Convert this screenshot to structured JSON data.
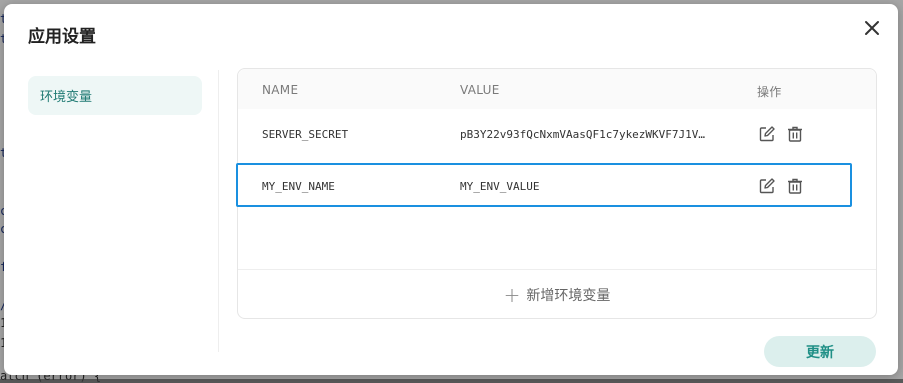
{
  "background_code": {
    "bottom_line": "atch (error) {"
  },
  "dialog": {
    "title": "应用设置",
    "close_icon": "close-icon"
  },
  "sidebar": {
    "items": [
      {
        "label": "环境变量",
        "active": true
      }
    ]
  },
  "env_table": {
    "headers": {
      "name": "NAME",
      "value": "VALUE",
      "actions": "操作"
    },
    "rows": [
      {
        "name": "SERVER_SECRET",
        "value": "pB3Y22v93fQcNxmVAasQF1c7ykezWKVF7J1V…"
      },
      {
        "name": "MY_ENV_NAME",
        "value": "MY_ENV_VALUE"
      }
    ],
    "add_label": "新增环境变量"
  },
  "footer": {
    "update_label": "更新"
  },
  "colors": {
    "accent": "#1f8f86",
    "selected_border": "#1a90e0",
    "sidebar_active_bg": "#eef7f6"
  }
}
